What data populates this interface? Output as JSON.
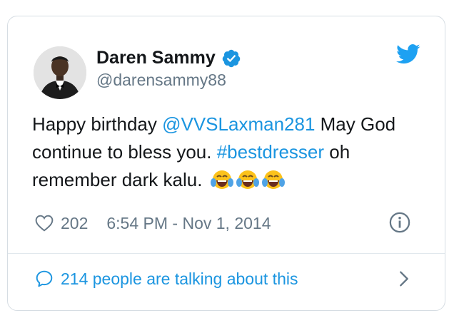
{
  "tweet": {
    "author": {
      "name": "Daren Sammy",
      "handle": "@darensammy88"
    },
    "text": {
      "intro": "Happy birthday ",
      "mention": "@VVSLaxman281",
      "line1_rest": " May God",
      "line2": "continue to bless you. ",
      "hashtag": "#bestdresser",
      "line2_rest": " oh",
      "line3": "remember dark kalu."
    },
    "emoji": [
      "face-with-tears-of-joy",
      "face-with-tears-of-joy",
      "face-with-tears-of-joy"
    ],
    "likes": "202",
    "timestamp": "6:54 PM - Nov 1, 2014",
    "conversation": "214 people are talking about this"
  },
  "icons": {
    "verified": "verified-badge-icon",
    "brand": "twitter-bird-icon",
    "like": "heart-icon",
    "info": "info-icon",
    "reply": "speech-bubble-icon",
    "open": "chevron-right-icon"
  },
  "colors": {
    "accent": "#1b95e0",
    "text": "#14171a",
    "secondary": "#657786",
    "border": "#d6dde3"
  }
}
